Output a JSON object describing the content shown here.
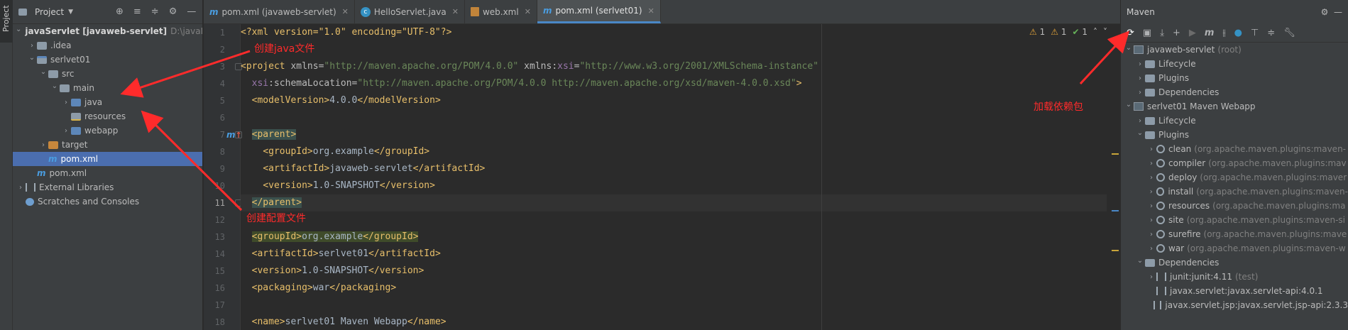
{
  "stripe": {
    "project_tab": "Project"
  },
  "project_panel": {
    "title": "Project",
    "tree": [
      {
        "label": "javaServlet [javaweb-servlet]",
        "path": "D:\\javaR",
        "level": 0,
        "expanded": true,
        "icon": "module-folder-icon"
      },
      {
        "label": ".idea",
        "level": 1,
        "expanded": false,
        "icon": "folder-icon"
      },
      {
        "label": "serlvet01",
        "level": 1,
        "expanded": true,
        "icon": "module-folder-icon"
      },
      {
        "label": "src",
        "level": 2,
        "expanded": true,
        "icon": "folder-icon"
      },
      {
        "label": "main",
        "level": 3,
        "expanded": true,
        "icon": "folder-icon"
      },
      {
        "label": "java",
        "level": 4,
        "expanded": false,
        "icon": "source-folder-icon"
      },
      {
        "label": "resources",
        "level": 4,
        "expanded": null,
        "icon": "resources-folder-icon"
      },
      {
        "label": "webapp",
        "level": 4,
        "expanded": false,
        "icon": "web-folder-icon"
      },
      {
        "label": "target",
        "level": 2,
        "expanded": false,
        "icon": "excluded-folder-icon"
      },
      {
        "label": "pom.xml",
        "level": 2,
        "expanded": null,
        "icon": "maven-file-icon",
        "selected": true
      },
      {
        "label": "pom.xml",
        "level": 1,
        "expanded": null,
        "icon": "maven-file-icon"
      },
      {
        "label": "External Libraries",
        "level": 0,
        "expanded": false,
        "icon": "library-icon"
      },
      {
        "label": "Scratches and Consoles",
        "level": 0,
        "expanded": null,
        "icon": "scratches-icon"
      }
    ]
  },
  "editor": {
    "tabs": [
      {
        "label": "pom.xml (javaweb-servlet)",
        "icon": "maven-file-icon",
        "active": false
      },
      {
        "label": "HelloServlet.java",
        "icon": "java-class-icon",
        "active": false
      },
      {
        "label": "web.xml",
        "icon": "xml-file-icon",
        "active": false
      },
      {
        "label": "pom.xml (serlvet01)",
        "icon": "maven-file-icon",
        "active": true
      }
    ],
    "inspections": {
      "warnings_a": "1",
      "warnings_b": "1",
      "ok": "1"
    },
    "current_line": 11,
    "lines": [
      {
        "n": "1"
      },
      {
        "n": "2"
      },
      {
        "n": "3"
      },
      {
        "n": "4"
      },
      {
        "n": "5"
      },
      {
        "n": "6"
      },
      {
        "n": "7"
      },
      {
        "n": "8"
      },
      {
        "n": "9"
      },
      {
        "n": "10"
      },
      {
        "n": "11"
      },
      {
        "n": "12"
      },
      {
        "n": "13"
      },
      {
        "n": "14"
      },
      {
        "n": "15"
      },
      {
        "n": "16"
      },
      {
        "n": "17"
      },
      {
        "n": "18"
      }
    ],
    "code": {
      "l1": "<?xml version=\"1.0\" encoding=\"UTF-8\"?>",
      "l3_tag": "<project ",
      "l3_attr1": "xmlns=",
      "l3_val1": "\"http://maven.apache.org/POM/4.0.0\"",
      "l3_attr2": " xmlns:",
      "l3_ns": "xsi",
      "l3_eq": "=",
      "l3_val2": "\"http://www.w3.org/2001/XMLSchema-instance\"",
      "l4_ns": "xsi",
      "l4_attr": ":schemaLocation=",
      "l4_val": "\"http://maven.apache.org/POM/4.0.0 http://maven.apache.org/xsd/maven-4.0.0.xsd\"",
      "l4_end": ">",
      "l5_open": "<modelVersion>",
      "l5_text": "4.0.0",
      "l5_close": "</modelVersion>",
      "l7": "<parent>",
      "l8_open": "<groupId>",
      "l8_text": "org.example",
      "l8_close": "</groupId>",
      "l9_open": "<artifactId>",
      "l9_text": "javaweb-servlet",
      "l9_close": "</artifactId>",
      "l10_open": "<version>",
      "l10_text": "1.0-SNAPSHOT",
      "l10_close": "</version>",
      "l11": "</parent>",
      "l13_open": "<groupId>",
      "l13_text": "org.example",
      "l13_close": "</groupId>",
      "l14_open": "<artifactId>",
      "l14_text": "serlvet01",
      "l14_close": "</artifactId>",
      "l15_open": "<version>",
      "l15_text": "1.0-SNAPSHOT",
      "l15_close": "</version>",
      "l16_open": "<packaging>",
      "l16_text": "war",
      "l16_close": "</packaging>",
      "l18_open": "<name>",
      "l18_text": "serlvet01 Maven Webapp",
      "l18_close": "</name>"
    }
  },
  "maven_panel": {
    "title": "Maven",
    "tree": [
      {
        "label": "javaweb-servlet",
        "note": "(root)",
        "level": 0,
        "expanded": true,
        "icon": "maven-module-icon"
      },
      {
        "label": "Lifecycle",
        "note": "",
        "level": 1,
        "expanded": false,
        "icon": "folder-icon"
      },
      {
        "label": "Plugins",
        "note": "",
        "level": 1,
        "expanded": false,
        "icon": "folder-icon"
      },
      {
        "label": "Dependencies",
        "note": "",
        "level": 1,
        "expanded": false,
        "icon": "folder-icon"
      },
      {
        "label": "serlvet01 Maven Webapp",
        "note": "",
        "level": 0,
        "expanded": true,
        "icon": "maven-module-icon"
      },
      {
        "label": "Lifecycle",
        "note": "",
        "level": 1,
        "expanded": false,
        "icon": "folder-icon"
      },
      {
        "label": "Plugins",
        "note": "",
        "level": 1,
        "expanded": true,
        "icon": "folder-icon"
      },
      {
        "label": "clean",
        "note": "(org.apache.maven.plugins:maven-",
        "level": 2,
        "expanded": false,
        "icon": "plugin-icon"
      },
      {
        "label": "compiler",
        "note": "(org.apache.maven.plugins:mav",
        "level": 2,
        "expanded": false,
        "icon": "plugin-icon"
      },
      {
        "label": "deploy",
        "note": "(org.apache.maven.plugins:maver",
        "level": 2,
        "expanded": false,
        "icon": "plugin-icon"
      },
      {
        "label": "install",
        "note": "(org.apache.maven.plugins:maven-",
        "level": 2,
        "expanded": false,
        "icon": "plugin-icon"
      },
      {
        "label": "resources",
        "note": "(org.apache.maven.plugins:ma",
        "level": 2,
        "expanded": false,
        "icon": "plugin-icon"
      },
      {
        "label": "site",
        "note": "(org.apache.maven.plugins:maven-si",
        "level": 2,
        "expanded": false,
        "icon": "plugin-icon"
      },
      {
        "label": "surefire",
        "note": "(org.apache.maven.plugins:mave",
        "level": 2,
        "expanded": false,
        "icon": "plugin-icon"
      },
      {
        "label": "war",
        "note": "(org.apache.maven.plugins:maven-w",
        "level": 2,
        "expanded": false,
        "icon": "plugin-icon"
      },
      {
        "label": "Dependencies",
        "note": "",
        "level": 1,
        "expanded": true,
        "icon": "folder-icon"
      },
      {
        "label": "junit:junit:4.11",
        "note": "(test)",
        "level": 2,
        "expanded": false,
        "icon": "library-icon"
      },
      {
        "label": "javax.servlet:javax.servlet-api:4.0.1",
        "note": "",
        "level": 2,
        "expanded": null,
        "icon": "library-icon"
      },
      {
        "label": "javax.servlet.jsp:javax.servlet.jsp-api:2.3.3",
        "note": "",
        "level": 2,
        "expanded": null,
        "icon": "library-icon"
      }
    ]
  },
  "annotations": {
    "create_java": "创建java文件",
    "create_config": "创建配置文件",
    "load_deps": "加载依赖包",
    "color": "#ff2b2b"
  }
}
